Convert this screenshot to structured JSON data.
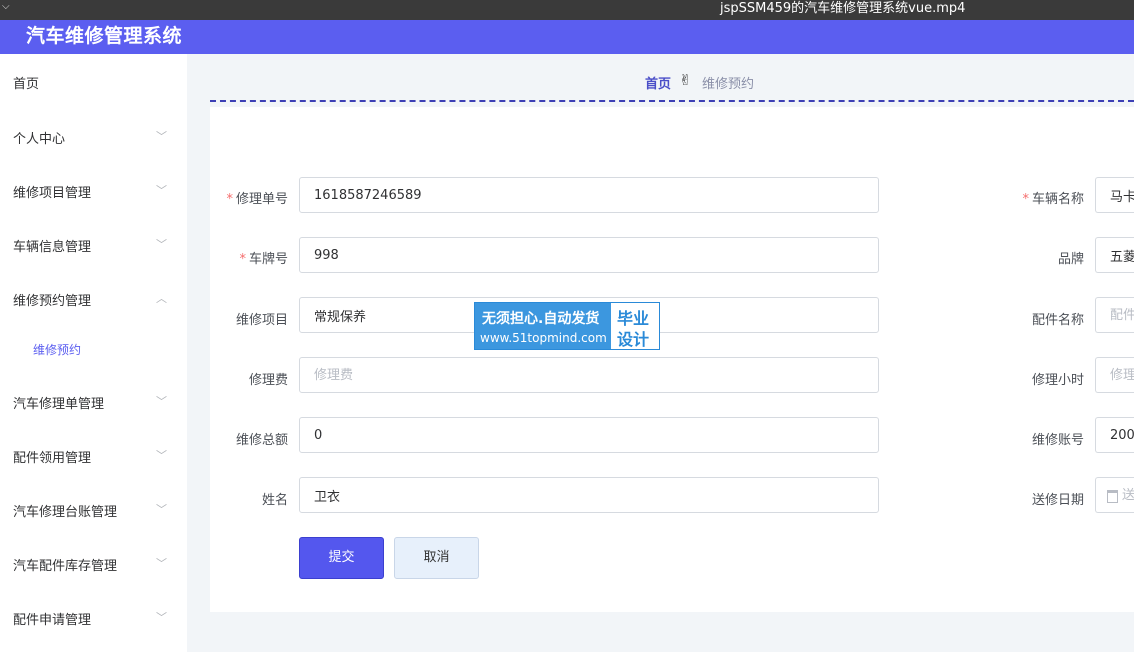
{
  "video": {
    "title": "jspSSM459的汽车维修管理系统vue.mp4"
  },
  "app": {
    "title": "汽车维修管理系统",
    "accent_color": "#5b5ef0"
  },
  "sidebar": {
    "items": [
      {
        "label": "首页"
      },
      {
        "label": "个人中心"
      },
      {
        "label": "维修项目管理"
      },
      {
        "label": "车辆信息管理"
      },
      {
        "label": "维修预约管理"
      },
      {
        "label": "维修预约"
      },
      {
        "label": "汽车修理单管理"
      },
      {
        "label": "配件领用管理"
      },
      {
        "label": "汽车修理台账管理"
      },
      {
        "label": "汽车配件库存管理"
      },
      {
        "label": "配件申请管理"
      }
    ],
    "arrow_down": "﹀",
    "arrow_up": "︿"
  },
  "breadcrumb": {
    "home": "首页",
    "separator_icon": "✌",
    "current": "维修预约"
  },
  "form": {
    "required_mark": "*",
    "left": [
      {
        "label": "修理单号",
        "value": "1618587246589",
        "placeholder": ""
      },
      {
        "label": "车牌号",
        "value": "998",
        "placeholder": ""
      },
      {
        "label": "维修项目",
        "value": "常规保养",
        "placeholder": ""
      },
      {
        "label": "修理费",
        "value": "",
        "placeholder": "修理费"
      },
      {
        "label": "维修总额",
        "value": "0",
        "placeholder": ""
      },
      {
        "label": "姓名",
        "value": "卫衣",
        "placeholder": ""
      }
    ],
    "right": [
      {
        "label": "车辆名称",
        "value": "马卡",
        "placeholder": ""
      },
      {
        "label": "品牌",
        "value": "五菱",
        "placeholder": ""
      },
      {
        "label": "配件名称",
        "value": "",
        "placeholder": "配件"
      },
      {
        "label": "修理小时",
        "value": "",
        "placeholder": "修理"
      },
      {
        "label": "维修账号",
        "value": "200",
        "placeholder": ""
      },
      {
        "label": "送修日期",
        "value": "",
        "placeholder": "送"
      }
    ],
    "submit_label": "提交",
    "cancel_label": "取消"
  },
  "watermark": {
    "line1": "无须担心.自动发货",
    "line2": "www.51topmind.com",
    "badge_line1": "毕业",
    "badge_line2": "设计"
  }
}
